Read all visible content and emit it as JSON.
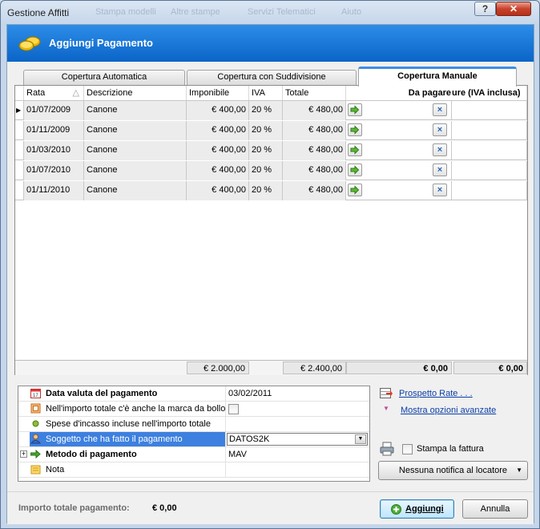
{
  "window": {
    "title": "Gestione Affitti",
    "ghost_menu": [
      "Stampa modelli",
      "Altre stampe",
      "Servizi Telematici",
      "Aiuto"
    ],
    "help_label": "?",
    "close_label": "✕"
  },
  "banner": {
    "title": "Aggiungi Pagamento"
  },
  "tabs": [
    {
      "label": "Copertura Automatica",
      "active": false
    },
    {
      "label": "Copertura con Suddivisione",
      "active": false
    },
    {
      "label": "Copertura Manuale",
      "active": true
    }
  ],
  "grid": {
    "columns": [
      "Rata",
      "Descrizione",
      "Imponibile",
      "IVA",
      "Totale",
      "",
      "Da pagare",
      "ure (IVA inclusa)"
    ],
    "rows": [
      {
        "rata": "01/07/2009",
        "descrizione": "Canone",
        "imponibile": "€ 400,00",
        "iva": "20 %",
        "totale": "€ 480,00"
      },
      {
        "rata": "01/11/2009",
        "descrizione": "Canone",
        "imponibile": "€ 400,00",
        "iva": "20 %",
        "totale": "€ 480,00"
      },
      {
        "rata": "01/03/2010",
        "descrizione": "Canone",
        "imponibile": "€ 400,00",
        "iva": "20 %",
        "totale": "€ 480,00"
      },
      {
        "rata": "01/07/2010",
        "descrizione": "Canone",
        "imponibile": "€ 400,00",
        "iva": "20 %",
        "totale": "€ 480,00"
      },
      {
        "rata": "01/11/2010",
        "descrizione": "Canone",
        "imponibile": "€ 400,00",
        "iva": "20 %",
        "totale": "€ 480,00"
      }
    ],
    "remove_label": "×",
    "footer": {
      "imponibile": "€ 2.000,00",
      "totale": "€ 2.400,00",
      "da_pagare": "€ 0,00",
      "fattura": "€ 0,00"
    }
  },
  "props": {
    "rows": [
      {
        "label": "Data valuta del pagamento",
        "value": "03/02/2011",
        "bold": true,
        "icon": "calendar-icon"
      },
      {
        "label": "Nell'importo totale c'è anche la marca da bollo",
        "value": "",
        "icon": "stamp-icon"
      },
      {
        "label": "Spese d'incasso incluse nell'importo totale",
        "value": "",
        "icon": "dot-icon"
      },
      {
        "label": "Soggetto che ha fatto il pagamento",
        "value": "DATOS2K",
        "selected": true,
        "icon": "person-icon"
      },
      {
        "label": "Metodo di pagamento",
        "value": "MAV",
        "bold": true,
        "icon": "arrow-icon"
      },
      {
        "label": "Nota",
        "value": "",
        "icon": "note-icon"
      }
    ]
  },
  "side": {
    "prospetto_link": "Prospetto Rate . . .",
    "opzioni_link": "Mostra opzioni avanzate",
    "stampa_label": "Stampa la fattura",
    "notifica_label": "Nessuna notifica al locatore"
  },
  "bottom": {
    "total_label": "Importo totale pagamento:",
    "total_value": "€ 0,00",
    "aggiungi_label": "Aggiungi",
    "annulla_label": "Annulla"
  },
  "colors": {
    "banner": "#1577dc",
    "selection": "#3d80df",
    "link": "#0b3fa8"
  }
}
